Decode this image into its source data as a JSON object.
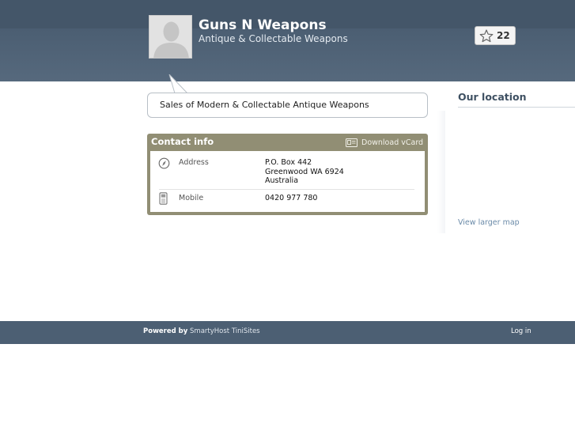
{
  "header": {
    "title": "Guns N Weapons",
    "subtitle": "Antique & Collectable Weapons",
    "favorites_count": "22",
    "avatar_icon": "person-silhouette-icon",
    "favorite_icon": "star-outline-icon"
  },
  "tagline": "Sales of Modern & Collectable Antique Weapons",
  "contact": {
    "title": "Contact info",
    "vcard_label": "Download vCard",
    "vcard_icon": "vcard-icon",
    "rows": [
      {
        "icon": "compass-icon",
        "label": "Address",
        "lines": [
          "P.O. Box 442",
          "Greenwood WA 6924",
          "Australia"
        ]
      },
      {
        "icon": "mobile-phone-icon",
        "label": "Mobile",
        "lines": [
          "0420 977 780"
        ]
      }
    ]
  },
  "location": {
    "title": "Our location",
    "map_link": "View larger map"
  },
  "footer": {
    "powered_prefix": "Powered by",
    "powered_name": "SmartyHost TiniSites",
    "login_label": "Log in"
  },
  "colors": {
    "header_bg": "#4b5e72",
    "contact_bg": "#918e74",
    "footer_bg": "#4c5f73",
    "link": "#6a8aa8"
  }
}
